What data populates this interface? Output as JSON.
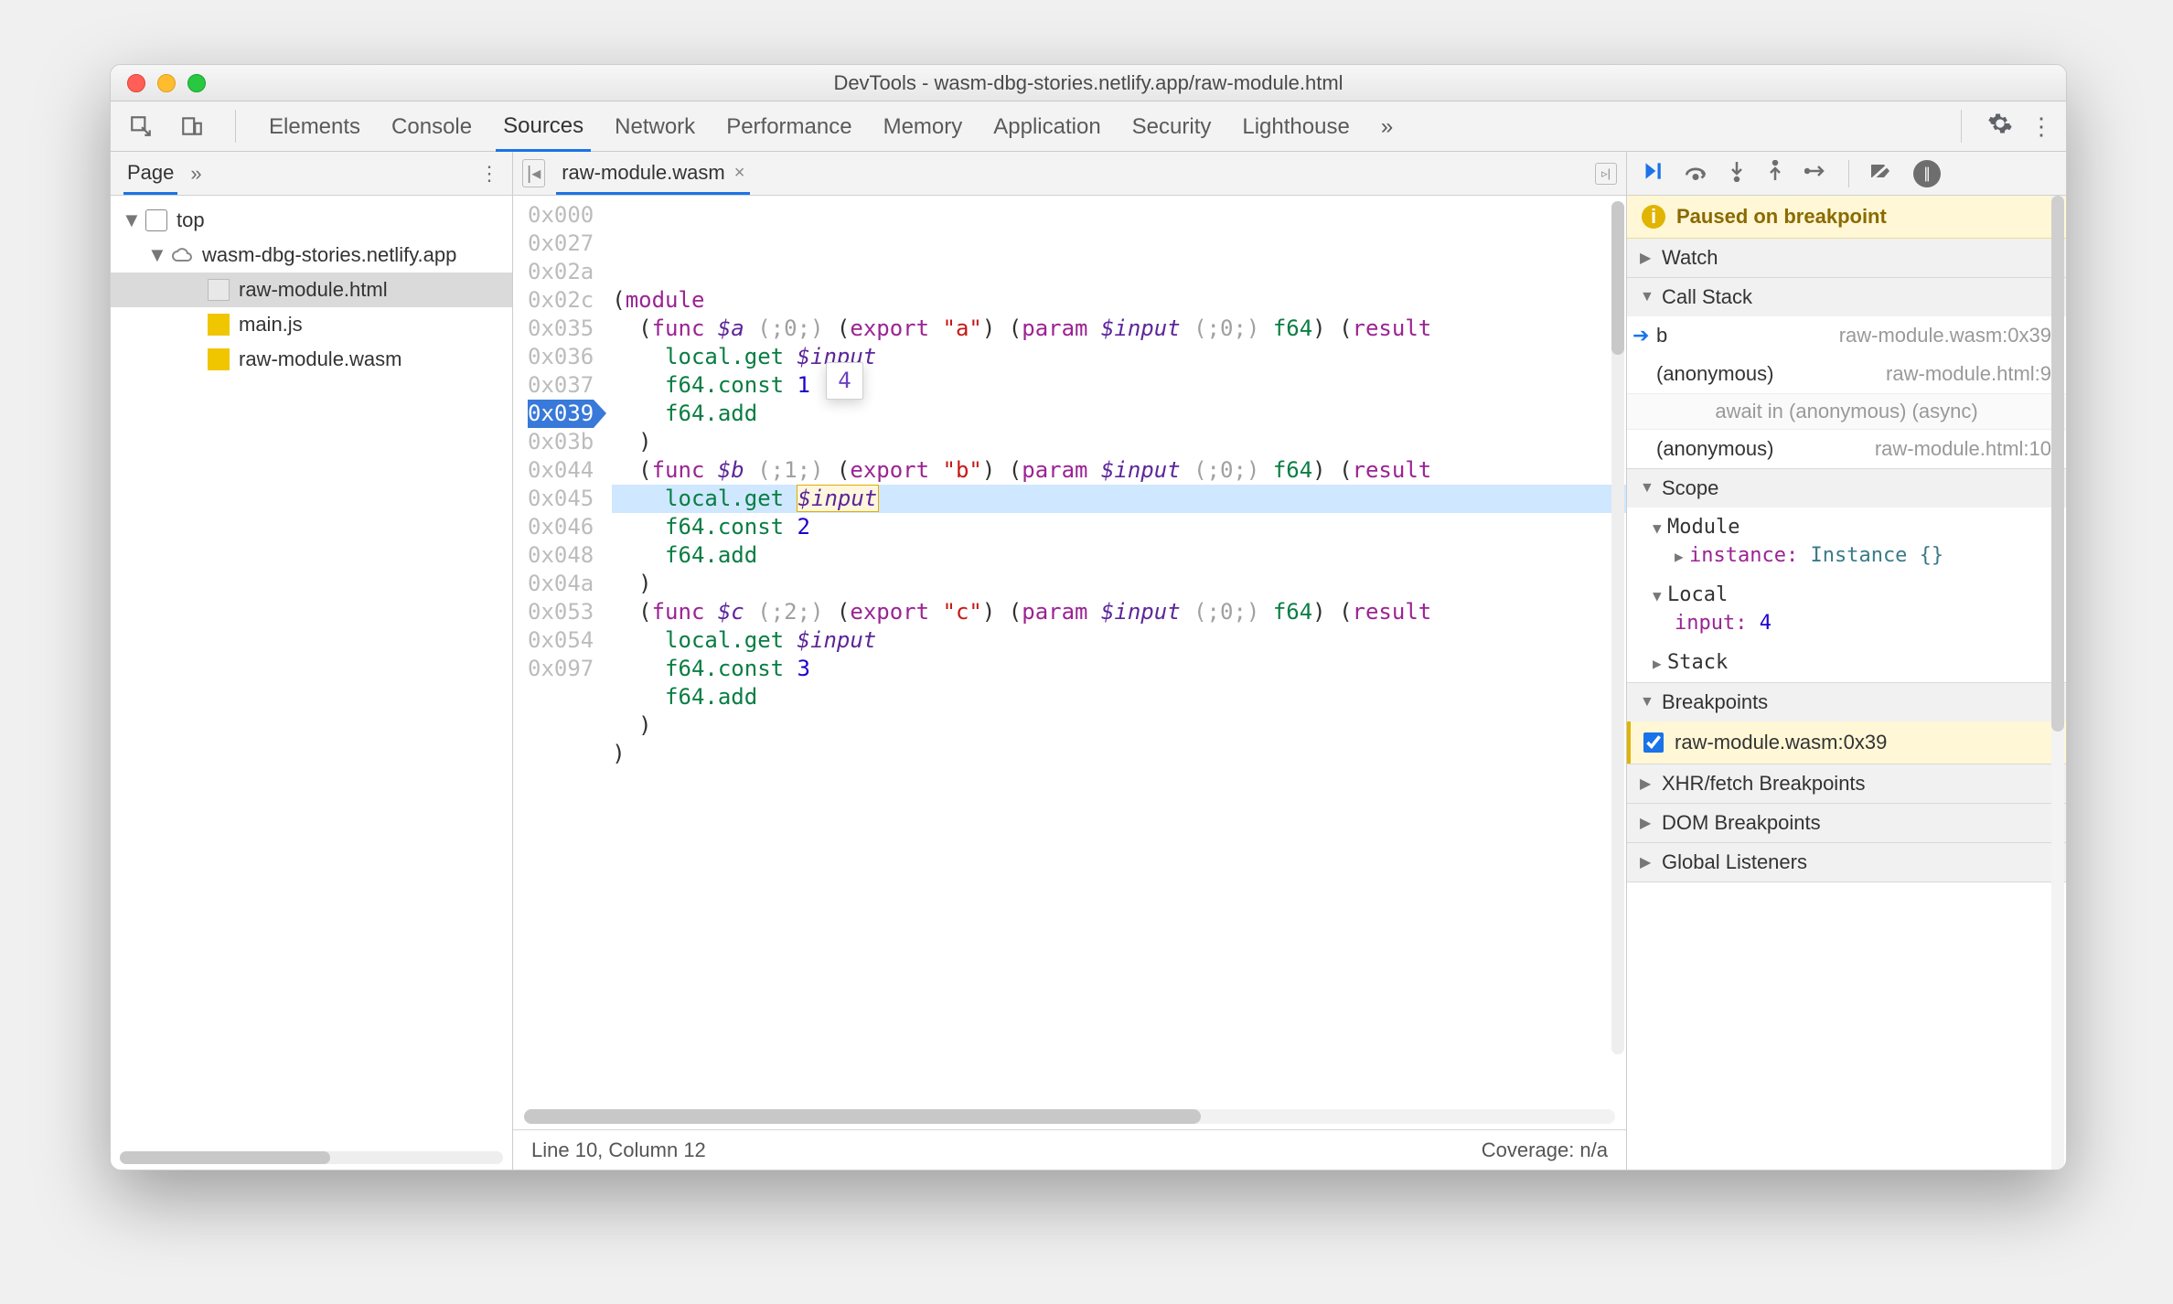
{
  "window": {
    "title": "DevTools - wasm-dbg-stories.netlify.app/raw-module.html"
  },
  "tabs": {
    "items": [
      "Elements",
      "Console",
      "Sources",
      "Network",
      "Performance",
      "Memory",
      "Application",
      "Security",
      "Lighthouse"
    ],
    "active": "Sources",
    "overflow_glyph": "»"
  },
  "page_panel": {
    "label": "Page",
    "overflow_glyph": "»",
    "tree": {
      "top": "top",
      "domain": "wasm-dbg-stories.netlify.app",
      "files": [
        "raw-module.html",
        "main.js",
        "raw-module.wasm"
      ],
      "selected": "raw-module.html"
    }
  },
  "editor": {
    "filename": "raw-module.wasm",
    "hover_tooltip": "4",
    "status_left": "Line 10, Column 12",
    "status_right": "Coverage: n/a",
    "offsets": [
      "0x000",
      "0x027",
      "0x02a",
      "0x02c",
      "0x035",
      "0x036",
      "0x037",
      "0x039",
      "0x03b",
      "0x044",
      "0x045",
      "0x046",
      "0x048",
      "0x04a",
      "0x053",
      "0x054",
      "0x097"
    ],
    "highlight_offset": "0x039",
    "lines": [
      {
        "raw": "(module",
        "tokens": [
          [
            "(",
            "p"
          ],
          [
            "module",
            "kw"
          ]
        ]
      },
      {
        "raw": "  (func $a (;0;) (export \"a\") (param $input (;0;) f64) (result",
        "tokens": [
          [
            "  (",
            "p"
          ],
          [
            "func",
            "kw"
          ],
          [
            " ",
            "p"
          ],
          [
            "$a",
            "var"
          ],
          [
            " ",
            "p"
          ],
          [
            "(;0;)",
            "comment"
          ],
          [
            " (",
            "p"
          ],
          [
            "export",
            "kw"
          ],
          [
            " ",
            "p"
          ],
          [
            "\"a\"",
            "str"
          ],
          [
            ") (",
            "p"
          ],
          [
            "param",
            "kw"
          ],
          [
            " ",
            "p"
          ],
          [
            "$input",
            "var"
          ],
          [
            " ",
            "p"
          ],
          [
            "(;0;)",
            "comment"
          ],
          [
            " ",
            "p"
          ],
          [
            "f64",
            "kw2"
          ],
          [
            ") (",
            "p"
          ],
          [
            "result",
            "kw"
          ]
        ]
      },
      {
        "raw": "    local.get $input",
        "tokens": [
          [
            "    ",
            "p"
          ],
          [
            "local.get",
            "kw2"
          ],
          [
            " ",
            "p"
          ],
          [
            "$input",
            "var"
          ]
        ]
      },
      {
        "raw": "    f64.const 1",
        "tokens": [
          [
            "    ",
            "p"
          ],
          [
            "f64.const",
            "kw2"
          ],
          [
            " ",
            "p"
          ],
          [
            "1",
            "num"
          ]
        ]
      },
      {
        "raw": "    f64.add",
        "tokens": [
          [
            "    ",
            "p"
          ],
          [
            "f64.add",
            "kw2"
          ]
        ]
      },
      {
        "raw": "  )",
        "tokens": [
          [
            "  )",
            "p"
          ]
        ]
      },
      {
        "raw": "  (func $b (;1;) (export \"b\") (param $input (;0;) f64) (result",
        "tokens": [
          [
            "  (",
            "p"
          ],
          [
            "func",
            "kw"
          ],
          [
            " ",
            "p"
          ],
          [
            "$b",
            "var"
          ],
          [
            " ",
            "p"
          ],
          [
            "(;1;)",
            "comment"
          ],
          [
            " (",
            "p"
          ],
          [
            "export",
            "kw"
          ],
          [
            " ",
            "p"
          ],
          [
            "\"b\"",
            "str"
          ],
          [
            ") (",
            "p"
          ],
          [
            "param",
            "kw"
          ],
          [
            " ",
            "p"
          ],
          [
            "$input",
            "var"
          ],
          [
            " ",
            "p"
          ],
          [
            "(;0;)",
            "comment"
          ],
          [
            " ",
            "p"
          ],
          [
            "f64",
            "kw2"
          ],
          [
            ") (",
            "p"
          ],
          [
            "result",
            "kw"
          ]
        ]
      },
      {
        "raw": "    local.get $input",
        "hl": true,
        "tokens": [
          [
            "    ",
            "p"
          ],
          [
            "local.get",
            "kw2"
          ],
          [
            " ",
            "p"
          ],
          [
            "$input",
            "var-boxed"
          ]
        ]
      },
      {
        "raw": "    f64.const 2",
        "tokens": [
          [
            "    ",
            "p"
          ],
          [
            "f64.const",
            "kw2"
          ],
          [
            " ",
            "p"
          ],
          [
            "2",
            "num"
          ]
        ]
      },
      {
        "raw": "    f64.add",
        "tokens": [
          [
            "    ",
            "p"
          ],
          [
            "f64.add",
            "kw2"
          ]
        ]
      },
      {
        "raw": "  )",
        "tokens": [
          [
            "  )",
            "p"
          ]
        ]
      },
      {
        "raw": "  (func $c (;2;) (export \"c\") (param $input (;0;) f64) (result",
        "tokens": [
          [
            "  (",
            "p"
          ],
          [
            "func",
            "kw"
          ],
          [
            " ",
            "p"
          ],
          [
            "$c",
            "var"
          ],
          [
            " ",
            "p"
          ],
          [
            "(;2;)",
            "comment"
          ],
          [
            " (",
            "p"
          ],
          [
            "export",
            "kw"
          ],
          [
            " ",
            "p"
          ],
          [
            "\"c\"",
            "str"
          ],
          [
            ") (",
            "p"
          ],
          [
            "param",
            "kw"
          ],
          [
            " ",
            "p"
          ],
          [
            "$input",
            "var"
          ],
          [
            " ",
            "p"
          ],
          [
            "(;0;)",
            "comment"
          ],
          [
            " ",
            "p"
          ],
          [
            "f64",
            "kw2"
          ],
          [
            ") (",
            "p"
          ],
          [
            "result",
            "kw"
          ]
        ]
      },
      {
        "raw": "    local.get $input",
        "tokens": [
          [
            "    ",
            "p"
          ],
          [
            "local.get",
            "kw2"
          ],
          [
            " ",
            "p"
          ],
          [
            "$input",
            "var"
          ]
        ]
      },
      {
        "raw": "    f64.const 3",
        "tokens": [
          [
            "    ",
            "p"
          ],
          [
            "f64.const",
            "kw2"
          ],
          [
            " ",
            "p"
          ],
          [
            "3",
            "num"
          ]
        ]
      },
      {
        "raw": "    f64.add",
        "tokens": [
          [
            "    ",
            "p"
          ],
          [
            "f64.add",
            "kw2"
          ]
        ]
      },
      {
        "raw": "  )",
        "tokens": [
          [
            "  )",
            "p"
          ]
        ]
      },
      {
        "raw": ")",
        "tokens": [
          [
            ")",
            "p"
          ]
        ]
      }
    ]
  },
  "debugger": {
    "paused_banner": "Paused on breakpoint",
    "sections": {
      "watch": "Watch",
      "callstack": "Call Stack",
      "scope": "Scope",
      "breakpoints": "Breakpoints",
      "xhr": "XHR/fetch Breakpoints",
      "dom": "DOM Breakpoints",
      "global": "Global Listeners"
    },
    "callstack": [
      {
        "name": "b",
        "loc": "raw-module.wasm:0x39",
        "active": true
      },
      {
        "name": "(anonymous)",
        "loc": "raw-module.html:9"
      },
      {
        "sep": "await in (anonymous) (async)"
      },
      {
        "name": "(anonymous)",
        "loc": "raw-module.html:10"
      }
    ],
    "scope": {
      "module_label": "Module",
      "module_entry_key": "instance",
      "module_entry_val": "Instance {}",
      "local_label": "Local",
      "local_entry_key": "input",
      "local_entry_val": "4",
      "stack_label": "Stack"
    },
    "breakpoints": [
      {
        "label": "raw-module.wasm:0x39",
        "checked": true
      }
    ]
  }
}
